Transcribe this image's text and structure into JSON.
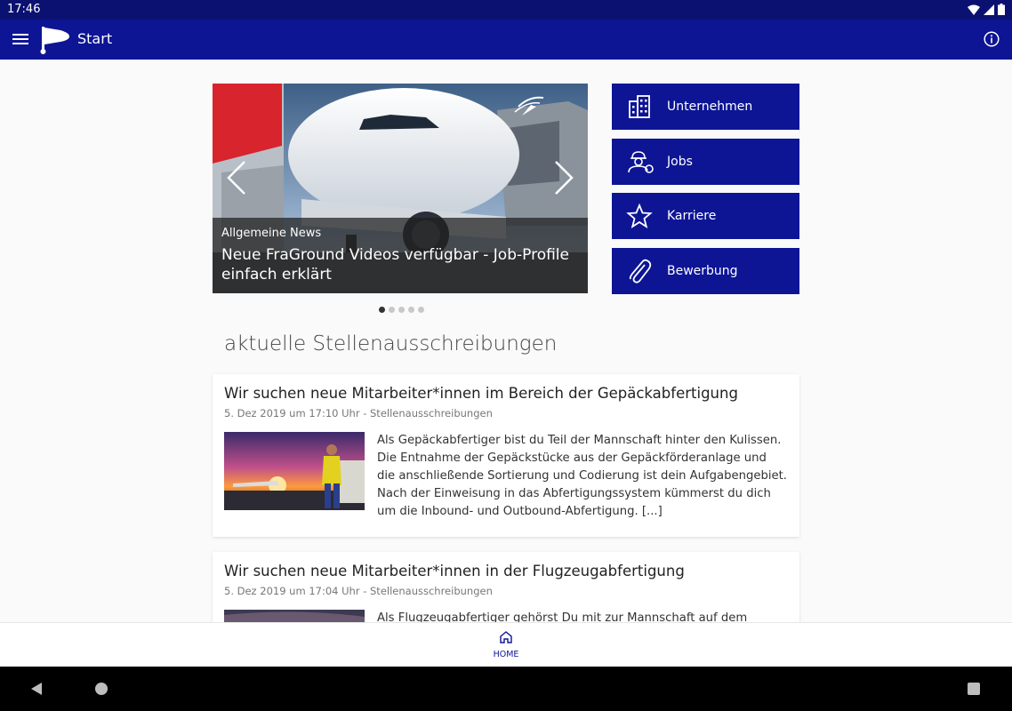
{
  "status_bar": {
    "time": "17:46"
  },
  "app_bar": {
    "title": "Start"
  },
  "carousel": {
    "category": "Allgemeine News",
    "headline": "Neue FraGround Videos verfügbar - Job-Profile einfach erklärt",
    "dot_count": 5,
    "active_index": 0
  },
  "tiles": [
    {
      "label": "Unternehmen",
      "icon": "building-icon"
    },
    {
      "label": "Jobs",
      "icon": "worker-icon"
    },
    {
      "label": "Karriere",
      "icon": "star-icon"
    },
    {
      "label": "Bewerbung",
      "icon": "paperclip-icon"
    }
  ],
  "section_title": "aktuelle Stellenausschreibungen",
  "posts": [
    {
      "title": "Wir suchen neue Mitarbeiter*innen im Bereich der Gepäckabfertigung",
      "meta": "5. Dez 2019 um 17:10 Uhr - Stellenausschreibungen",
      "excerpt": "Als Gepäckabfertiger bist du Teil der Mannschaft hinter den Kulissen. Die Entnahme der Gepäckstücke aus der Gepäckförderanlage und die anschließende Sortierung und Codierung ist dein Aufgabengebiet. Nach der Einweisung in das Abfertigungssystem kümmerst du dich um die Inbound- und Outbound-Abfertigung. [...]"
    },
    {
      "title": "Wir suchen neue Mitarbeiter*innen in der Flugzeugabfertigung",
      "meta": "5. Dez 2019 um 17:04 Uhr - Stellenausschreibungen",
      "excerpt": "Als Flugzeugabfertiger gehörst Du mit zur Mannschaft auf dem Vorfeld"
    }
  ],
  "bottom_nav": {
    "home_label": "HOME"
  },
  "colors": {
    "primary": "#0d1595",
    "status_bar": "#0a1170"
  }
}
